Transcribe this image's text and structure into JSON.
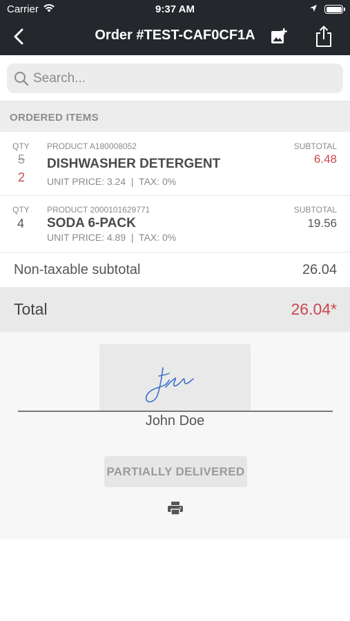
{
  "status_bar": {
    "carrier": "Carrier",
    "time": "9:37 AM",
    "icons": [
      "wifi-icon",
      "location-arrow-icon",
      "battery-icon"
    ]
  },
  "nav": {
    "title": "Order #TEST-CAF0CF1A",
    "back_icon": "chevron-left-icon",
    "photo_icon": "add-photo-icon",
    "share_icon": "share-icon"
  },
  "search": {
    "placeholder": "Search...",
    "value": ""
  },
  "section": {
    "title": "ORDERED ITEMS"
  },
  "items": [
    {
      "qty_label": "QTY",
      "qty_original": "5",
      "qty_delivered": "2",
      "product_code": "PRODUCT A180008052",
      "name": "DISHWASHER DETERGENT",
      "meta": "UNIT PRICE: 3.24  |  TAX: 0%",
      "subtotal_label": "SUBTOTAL",
      "subtotal": "6.48"
    },
    {
      "qty_label": "QTY",
      "qty": "4",
      "product_code": "PRODUCT 2000101629771",
      "name": "SODA 6-PACK",
      "meta": "UNIT PRICE: 4.89  |  TAX: 0%",
      "subtotal_label": "SUBTOTAL",
      "subtotal": "19.56"
    }
  ],
  "summary": {
    "nontaxable_label": "Non-taxable subtotal",
    "nontaxable_value": "26.04",
    "total_label": "Total",
    "total_value": "26.04*"
  },
  "signature": {
    "name": "John Doe"
  },
  "order_status": "PARTIALLY DELIVERED",
  "colors": {
    "header_bg": "#24272b",
    "accent_red": "#c9484e",
    "signature_ink": "#3b6fc9"
  }
}
